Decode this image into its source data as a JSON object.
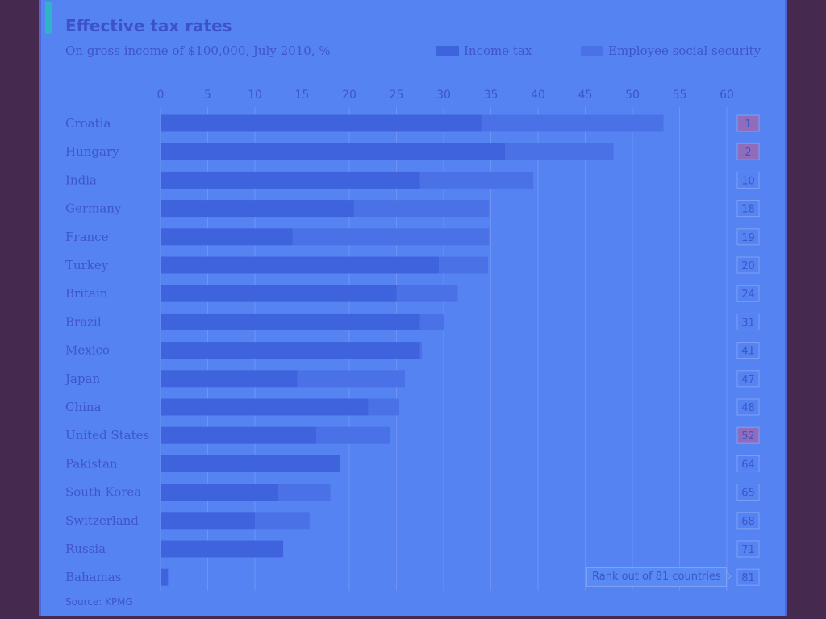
{
  "header": {
    "title": "Effective tax rates",
    "subtitle": "On gross income of $100,000, July 2010, %",
    "source": "Source: KPMG",
    "rank_note": "Rank out of 81 countries"
  },
  "colors": {
    "income_tax": "#3f63dd",
    "social_security": "#4a72e6",
    "grid": "#6f93f5",
    "highlight_rank": "#c25a8e"
  },
  "chart_data": {
    "type": "bar",
    "orientation": "horizontal",
    "stacked": true,
    "title": "Effective tax rates",
    "subtitle": "On gross income of $100,000, July 2010, %",
    "xlim": [
      0,
      60
    ],
    "xticks": [
      0,
      5,
      10,
      15,
      20,
      25,
      30,
      35,
      40,
      45,
      50,
      55,
      60
    ],
    "grid": true,
    "legend_position": "top-right",
    "categories": [
      "Croatia",
      "Hungary",
      "India",
      "Germany",
      "France",
      "Turkey",
      "Britain",
      "Brazil",
      "Mexico",
      "Japan",
      "China",
      "United States",
      "Pakistan",
      "South Korea",
      "Switzerland",
      "Russia",
      "Bahamas"
    ],
    "series": [
      {
        "name": "Income tax",
        "values": [
          34,
          36.5,
          27.5,
          20.5,
          14,
          29.5,
          25,
          27.5,
          27.5,
          14.5,
          22,
          16.5,
          19,
          12.5,
          10,
          13,
          0.8
        ]
      },
      {
        "name": "Employee social security",
        "values": [
          19.3,
          11.5,
          12,
          14.3,
          20.8,
          5.2,
          6.5,
          2.5,
          0.2,
          11.4,
          3.3,
          7.8,
          0,
          5.5,
          5.8,
          0,
          0
        ]
      }
    ],
    "ranks": [
      "1",
      "2",
      "10",
      "18",
      "19",
      "20",
      "24",
      "31",
      "41",
      "47",
      "48",
      "52",
      "64",
      "65",
      "68",
      "71",
      "81"
    ],
    "highlighted_ranks": [
      "1",
      "2",
      "52"
    ]
  }
}
